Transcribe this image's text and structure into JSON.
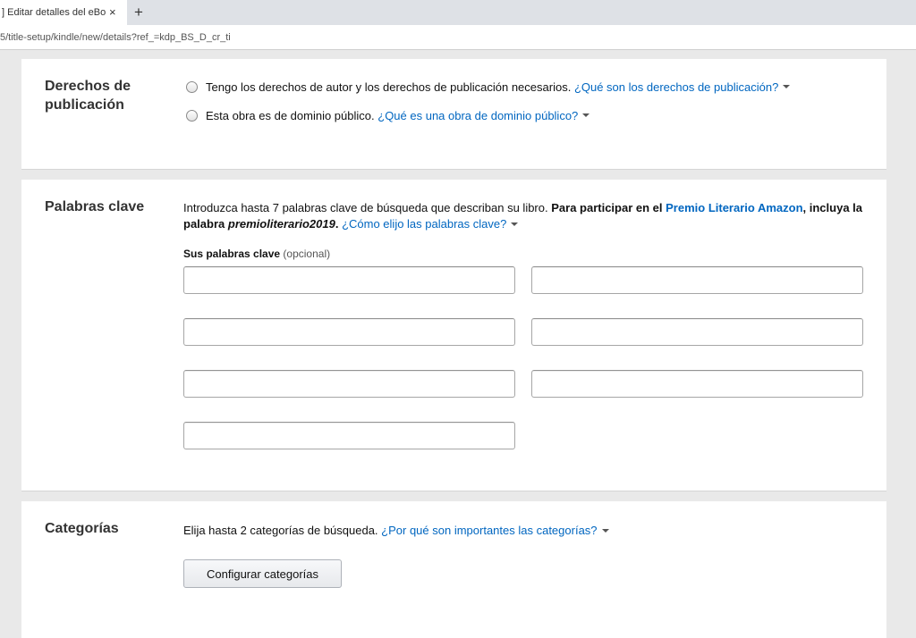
{
  "browser": {
    "tab_title": "] Editar detalles del eBook |",
    "tab_close": "×",
    "new_tab": "+",
    "url": "5/title-setup/kindle/new/details?ref_=kdp_BS_D_cr_ti"
  },
  "rights": {
    "title_line1": "Derechos de",
    "title_line2": "publicación",
    "options": [
      {
        "text": "Tengo los derechos de autor y los derechos de publicación necesarios.",
        "help": "¿Qué son los derechos de publicación?"
      },
      {
        "text": "Esta obra es de dominio público.",
        "help": "¿Qué es una obra de dominio público?"
      }
    ]
  },
  "keywords": {
    "title": "Palabras clave",
    "intro_plain": "Introduzca hasta 7 palabras clave de búsqueda que describan su libro.",
    "intro_bold1": "Para participar en el",
    "intro_award_link": "Premio Literario Amazon",
    "intro_bold2": ", incluya la palabra",
    "intro_keyword": "premioliterario2019",
    "intro_period": ".",
    "help": "¿Cómo elijo las palabras clave?",
    "label": "Sus palabras clave",
    "label_optional": "(opcional)",
    "inputs": [
      "",
      "",
      "",
      "",
      "",
      "",
      ""
    ]
  },
  "categories": {
    "title": "Categorías",
    "text": "Elija hasta 2 categorías de búsqueda.",
    "help": "¿Por qué son importantes las categorías?",
    "button": "Configurar categorías"
  }
}
